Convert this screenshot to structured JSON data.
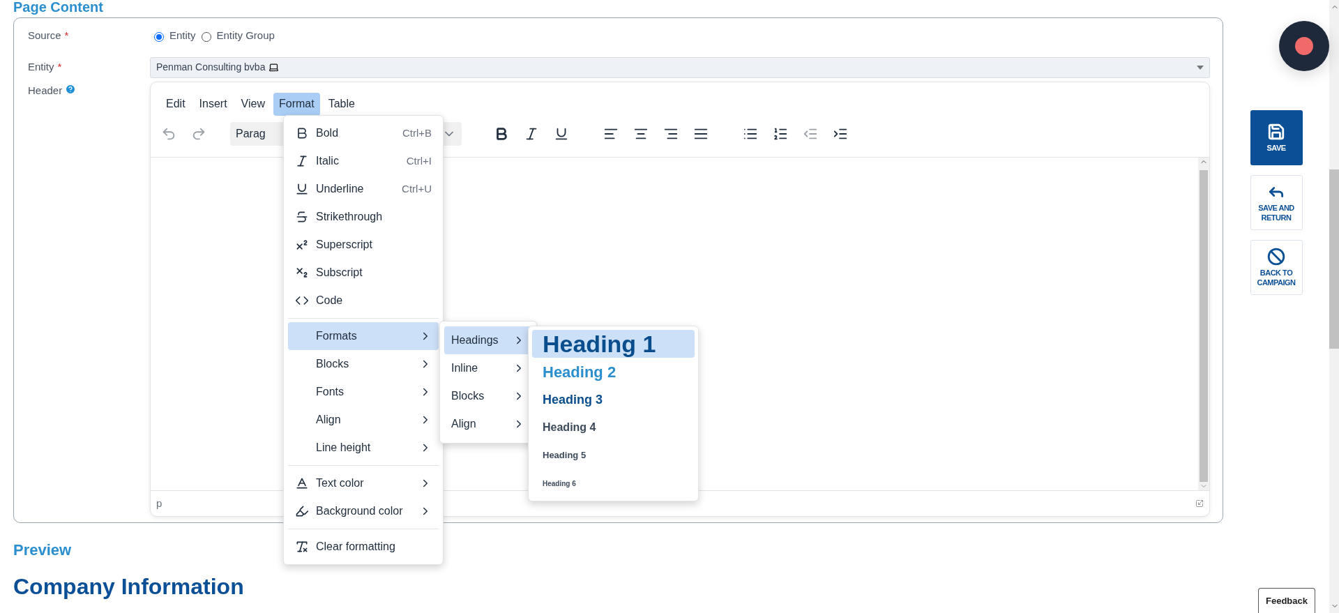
{
  "section_title": "Page Content",
  "form": {
    "source": {
      "label": "Source",
      "required": "*",
      "options": [
        {
          "label": "Entity",
          "selected": true
        },
        {
          "label": "Entity Group",
          "selected": false
        }
      ]
    },
    "entity": {
      "label": "Entity",
      "required": "*",
      "value": "Penman Consulting bvba"
    },
    "header": {
      "label": "Header"
    }
  },
  "editor": {
    "menubar": [
      {
        "label": "Edit",
        "selected": false
      },
      {
        "label": "Insert",
        "selected": false
      },
      {
        "label": "View",
        "selected": false
      },
      {
        "label": "Format",
        "selected": true
      },
      {
        "label": "Table",
        "selected": false
      }
    ],
    "toolbar": [
      {
        "kind": "undo",
        "disabled": true
      },
      {
        "kind": "redo",
        "disabled": true
      },
      {
        "kind": "block-select",
        "value": "Parag"
      },
      {
        "kind": "bold",
        "disabled": false
      },
      {
        "kind": "italic",
        "disabled": false
      },
      {
        "kind": "underline",
        "disabled": false
      },
      {
        "kind": "align-left",
        "disabled": false
      },
      {
        "kind": "align-center",
        "disabled": false
      },
      {
        "kind": "align-right",
        "disabled": false
      },
      {
        "kind": "align-justify",
        "disabled": false
      },
      {
        "kind": "bullet-list",
        "disabled": false
      },
      {
        "kind": "numbered-list",
        "disabled": false
      },
      {
        "kind": "outdent",
        "disabled": true
      },
      {
        "kind": "indent",
        "disabled": false
      }
    ],
    "statusbar": "p"
  },
  "format_menu": [
    [
      {
        "kind": "bold",
        "label": "Bold",
        "shortcut": "Ctrl+B",
        "selected": false
      },
      {
        "kind": "italic",
        "label": "Italic",
        "shortcut": "Ctrl+I",
        "selected": false
      },
      {
        "kind": "underline",
        "label": "Underline",
        "shortcut": "Ctrl+U",
        "selected": false
      },
      {
        "kind": "strikethrough",
        "label": "Strikethrough",
        "selected": false
      },
      {
        "kind": "superscript",
        "label": "Superscript",
        "selected": false
      },
      {
        "kind": "subscript",
        "label": "Subscript",
        "selected": false
      },
      {
        "kind": "code",
        "label": "Code",
        "selected": false
      }
    ],
    [
      {
        "kind": "submenu",
        "label": "Formats",
        "selected": true
      },
      {
        "kind": "submenu",
        "label": "Blocks",
        "selected": false
      },
      {
        "kind": "submenu",
        "label": "Fonts",
        "selected": false
      },
      {
        "kind": "submenu",
        "label": "Align",
        "selected": false
      },
      {
        "kind": "submenu",
        "label": "Line height",
        "selected": false
      }
    ],
    [
      {
        "kind": "text-color",
        "label": "Text color",
        "submenu": true,
        "selected": false
      },
      {
        "kind": "background-color",
        "label": "Background color",
        "submenu": true,
        "selected": false
      }
    ],
    [
      {
        "kind": "clear-formatting",
        "label": "Clear formatting",
        "selected": false
      }
    ]
  ],
  "formats_menu": [
    {
      "label": "Headings",
      "selected": true
    },
    {
      "label": "Inline",
      "selected": false
    },
    {
      "label": "Blocks",
      "selected": false
    },
    {
      "label": "Align",
      "selected": false
    }
  ],
  "headings_menu": [
    {
      "kind": "h1",
      "label": "Heading 1",
      "selected": true
    },
    {
      "kind": "h2",
      "label": "Heading 2",
      "selected": false
    },
    {
      "kind": "h3",
      "label": "Heading 3",
      "selected": false
    },
    {
      "kind": "h4",
      "label": "Heading 4",
      "selected": false
    },
    {
      "kind": "h5",
      "label": "Heading 5",
      "selected": false
    },
    {
      "kind": "h6",
      "label": "Heading 6",
      "selected": false
    }
  ],
  "preview": {
    "title": "Preview",
    "heading": "Company Information"
  },
  "side_buttons": [
    {
      "kind": "save",
      "label": "SAVE",
      "primary": true
    },
    {
      "kind": "save-return",
      "label": "SAVE AND RETURN",
      "primary": false
    },
    {
      "kind": "back",
      "label": "BACK TO CAMPAIGN",
      "primary": false
    }
  ],
  "feedback": "Feedback"
}
